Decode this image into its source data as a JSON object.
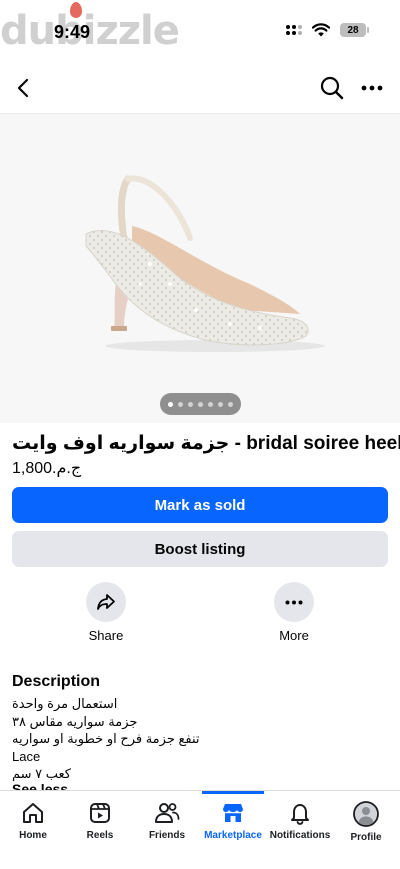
{
  "watermark": {
    "text": "dubizzle"
  },
  "status_bar": {
    "time": "9:49",
    "battery": "28"
  },
  "listing": {
    "title": "جزمة سواريه اوف وايت - bridal soiree heels",
    "price": "ج.م.1,800",
    "photo_count": 7,
    "active_photo": 1
  },
  "actions": {
    "mark_sold": "Mark as sold",
    "boost": "Boost listing",
    "share": "Share",
    "more": "More"
  },
  "description": {
    "heading": "Description",
    "lines": [
      "استعمال مرة واحدة",
      "جزمة سواريه مقاس ٣٨",
      "تنفع جزمة فرح او خطوبة او سواريه",
      "Lace",
      "كعب ٧ سم"
    ],
    "see_less": "See less"
  },
  "tabs": [
    {
      "label": "Home",
      "icon": "home-icon"
    },
    {
      "label": "Reels",
      "icon": "reels-icon"
    },
    {
      "label": "Friends",
      "icon": "friends-icon"
    },
    {
      "label": "Marketplace",
      "icon": "marketplace-icon",
      "active": true
    },
    {
      "label": "Notifications",
      "icon": "bell-icon"
    },
    {
      "label": "Profile",
      "icon": "profile-avatar-icon"
    }
  ],
  "colors": {
    "accent": "#0866ff",
    "secondary_button": "#e4e6eb",
    "text": "#050505"
  }
}
